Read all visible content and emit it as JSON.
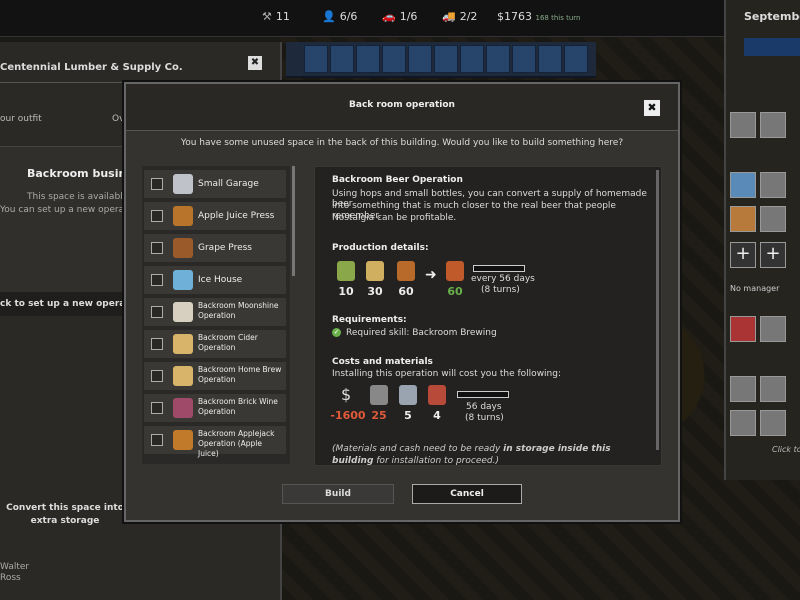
{
  "topbar": {
    "workers": "11",
    "people": "6/6",
    "vehicles": "1/6",
    "trucks": "2/2",
    "money": "$1763",
    "money_extra": "168 this turn"
  },
  "left_panel": {
    "title": "Centennial Lumber & Supply Co.",
    "close": "✖",
    "row_left": "our outfit",
    "row_right": "Ov",
    "section_title": "Backroom business",
    "available_line1": "This space is available.",
    "available_line2": "You can set up a new operatio",
    "click_bar": "ck to set up a new operation h",
    "convert_label": "Convert this space into extra storage",
    "name1": "Walter",
    "name2": "Ross"
  },
  "right_panel": {
    "month": "September",
    "no_manager": "No manager",
    "click_to": "Click to"
  },
  "modal": {
    "title": "Back room operation",
    "close": "✖",
    "subtitle": "You have some unused space in the back of this building. Would you like to build something here?",
    "options": [
      {
        "label": "Small Garage",
        "color": "#bfc3c9"
      },
      {
        "label": "Apple Juice Press",
        "color": "#b8742a"
      },
      {
        "label": "Grape Press",
        "color": "#9a5a2a"
      },
      {
        "label": "Ice House",
        "color": "#6fb0d8"
      },
      {
        "label": "Backroom Moonshine Operation",
        "color": "#d7d0c0"
      },
      {
        "label": "Backroom Cider Operation",
        "color": "#d8b46a"
      },
      {
        "label": "Backroom Home Brew Operation",
        "color": "#d8b46a"
      },
      {
        "label": "Backroom Brick Wine Operation",
        "color": "#a04a6a"
      },
      {
        "label": "Backroom Applejack Operation (Apple Juice)",
        "color": "#c07a2a"
      }
    ],
    "detail": {
      "title": "Backroom Beer Operation",
      "desc_lines": [
        "Using hops and small bottles, you can convert a supply of homemade beer",
        "into something that is much closer to the real beer that people remember.",
        "Nostalgia can be profitable."
      ],
      "production_heading": "Production details:",
      "inputs": [
        {
          "icon": "hops-icon",
          "value": "10"
        },
        {
          "icon": "jar-icon",
          "value": "30"
        },
        {
          "icon": "bottle-icon",
          "value": "60"
        }
      ],
      "output_value": "60",
      "production_time": "every 56 days",
      "production_turns": "(8 turns)",
      "requirements_heading": "Requirements:",
      "required_skill": "Required skill: Backroom Brewing",
      "costs_heading": "Costs and materials",
      "costs_intro": "Installing this operation will cost you the following:",
      "costs": [
        {
          "icon": "dollar-icon",
          "symbol": "$",
          "value": "-1600",
          "color": "#e05a3a"
        },
        {
          "icon": "barrel-icon",
          "symbol": "",
          "value": "25",
          "color": "#e05a3a"
        },
        {
          "icon": "pipe-icon",
          "symbol": "",
          "value": "5",
          "color": "#eeeeee"
        },
        {
          "icon": "bricks-icon",
          "symbol": "",
          "value": "4",
          "color": "#eeeeee"
        }
      ],
      "build_time": "56 days",
      "build_turns": "(8 turns)",
      "note_pre": "(Materials and cash need to be ready ",
      "note_bold": "in storage inside this building",
      "note_post": " for installation to proceed.)"
    },
    "build_label": "Build",
    "cancel_label": "Cancel"
  }
}
